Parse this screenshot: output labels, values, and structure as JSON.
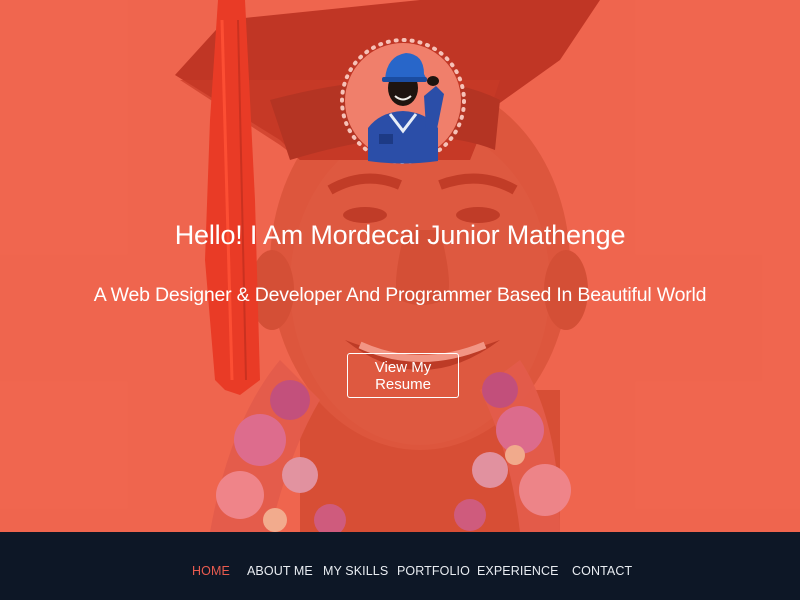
{
  "hero": {
    "headline": "Hello! I Am Mordecai Junior Mathenge",
    "subline": "A Web Designer & Developer And Programmer Based In Beautiful World",
    "cta_label": "View My Resume"
  },
  "nav": {
    "items": [
      {
        "label": "HOME",
        "active": true
      },
      {
        "label": "ABOUT ME",
        "active": false
      },
      {
        "label": "MY SKILLS",
        "active": false
      },
      {
        "label": "PORTFOLIO",
        "active": false
      },
      {
        "label": "EXPERIENCE",
        "active": false
      },
      {
        "label": "CONTACT",
        "active": false
      }
    ]
  },
  "colors": {
    "hero_overlay": "#f0654f",
    "nav_background": "#0d1726",
    "nav_active": "#e85b4f",
    "nav_text": "#e8ecf1"
  }
}
